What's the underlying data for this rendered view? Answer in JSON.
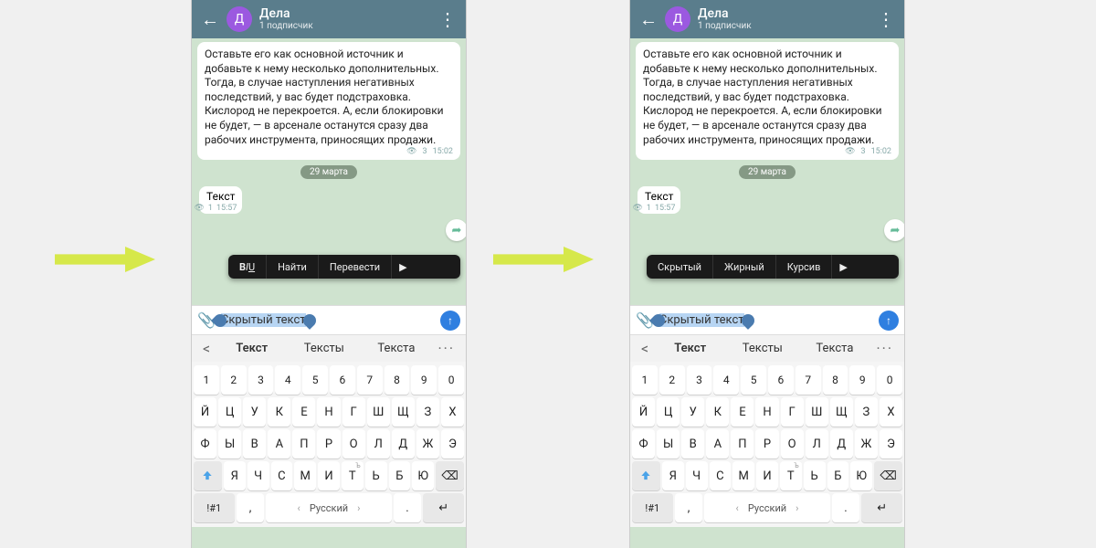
{
  "header": {
    "avatar_letter": "Д",
    "title": "Дела",
    "subtitle": "1 подписчик"
  },
  "message": {
    "text": "Оставьте его как основной источник и добавьте к нему несколько дополнительных. Тогда, в случае наступления негативных последствий, у вас будет подстраховка. Кислород не перекроется. А, если блокировки не будет, — в арсенале останутся сразу два рабочих инструмента, приносящих продажи.",
    "views": "3",
    "time": "15:02"
  },
  "date_chip": "29 марта",
  "small_msg": {
    "text": "Текст",
    "views": "1",
    "time": "15:57"
  },
  "context_menu_left": [
    "BIU",
    "Найти",
    "Перевести"
  ],
  "context_menu_right": [
    "Скрытый",
    "Жирный",
    "Курсив"
  ],
  "input_text": "Скрытый текст",
  "suggestions": {
    "back": "<",
    "items": [
      "Текст",
      "Тексты",
      "Текста"
    ],
    "more": "···"
  },
  "keyboard": {
    "row_num": [
      "1",
      "2",
      "3",
      "4",
      "5",
      "6",
      "7",
      "8",
      "9",
      "0"
    ],
    "row1": [
      "Й",
      "Ц",
      "У",
      "К",
      "Е",
      "Н",
      "Г",
      "Ш",
      "Щ",
      "З",
      "Х"
    ],
    "row2": [
      "Ф",
      "Ы",
      "В",
      "А",
      "П",
      "Р",
      "О",
      "Л",
      "Д",
      "Ж",
      "Э"
    ],
    "row3": [
      "Я",
      "Ч",
      "С",
      "М",
      "И",
      "Т",
      "Ь",
      "Б",
      "Ю"
    ],
    "row3_hints": {
      "Т": "Ъ"
    },
    "sym": "!#1",
    "space_lang": "Русский",
    "comma": ",",
    "period": "."
  }
}
